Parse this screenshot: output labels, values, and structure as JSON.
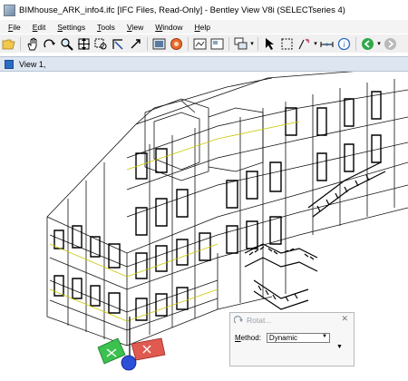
{
  "window": {
    "title": "BIMhouse_ARK_info4.ifc [IFC Files, Read-Only] - Bentley View V8i (SELECTseries 4)"
  },
  "menu": {
    "items": [
      {
        "u": "F",
        "rest": "ile"
      },
      {
        "u": "E",
        "rest": "dit"
      },
      {
        "u": "S",
        "rest": "ettings"
      },
      {
        "u": "T",
        "rest": "ools"
      },
      {
        "u": "V",
        "rest": "iew"
      },
      {
        "u": "W",
        "rest": "indow"
      },
      {
        "u": "H",
        "rest": "elp"
      }
    ]
  },
  "view": {
    "title": "View 1,"
  },
  "rotate_dialog": {
    "title": "Rotat...",
    "method_label_u": "M",
    "method_label_rest": "ethod:",
    "method_value": "Dynamic"
  },
  "icons": {
    "toolbar": [
      "open-folder-icon",
      "pan-hand-icon",
      "rotate-icon",
      "zoom-icon",
      "fit-view-icon",
      "window-area-icon",
      "view-previous-icon",
      "view-next-icon",
      "clip-volume-icon",
      "render-icon",
      "display-style-icon",
      "view-attributes-icon",
      "level-display-icon",
      "copy-view-icon",
      "select-arrow-icon",
      "fence-icon",
      "measure-icon",
      "distance-icon",
      "info-icon",
      "back-icon",
      "forward-icon"
    ]
  }
}
